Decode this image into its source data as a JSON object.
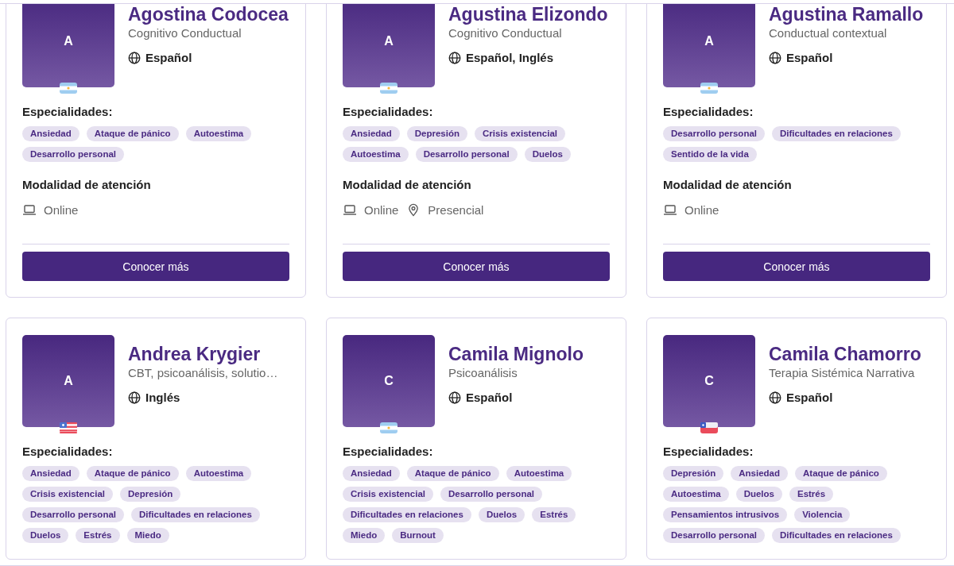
{
  "cards": [
    {
      "initial": "A",
      "flag": {
        "kind": "ar"
      },
      "name": "Agostina Codocea",
      "approach": "Cognitivo Conductual",
      "languages": "Español",
      "specialties_title": "Especialidades:",
      "specialties": [
        "Ansiedad",
        "Ataque de pánico",
        "Autoestima",
        "Desarrollo personal"
      ],
      "modality_title": "Modalidad de atención",
      "modalities": [
        {
          "kind": "online",
          "label": "Online"
        }
      ],
      "button": "Conocer más"
    },
    {
      "initial": "A",
      "flag": {
        "kind": "ar"
      },
      "name": "Agustina Elizondo",
      "approach": "Cognitivo Conductual",
      "languages": "Español, Inglés",
      "specialties_title": "Especialidades:",
      "specialties": [
        "Ansiedad",
        "Depresión",
        "Crisis existencial",
        "Autoestima",
        "Desarrollo personal",
        "Duelos"
      ],
      "modality_title": "Modalidad de atención",
      "modalities": [
        {
          "kind": "online",
          "label": "Online"
        },
        {
          "kind": "in_person",
          "label": "Presencial"
        }
      ],
      "button": "Conocer más"
    },
    {
      "initial": "A",
      "flag": {
        "kind": "ar"
      },
      "name": "Agustina Ramallo",
      "approach": "Conductual contextual",
      "languages": "Español",
      "specialties_title": "Especialidades:",
      "specialties": [
        "Desarrollo personal",
        "Dificultades en relaciones",
        "Sentido de la vida"
      ],
      "modality_title": "Modalidad de atención",
      "modalities": [
        {
          "kind": "online",
          "label": "Online"
        }
      ],
      "button": "Conocer más"
    },
    {
      "initial": "A",
      "flag": {
        "kind": "us"
      },
      "name": "Andrea Krygier",
      "approach": "CBT, psicoanálisis, solutio…",
      "languages": "Inglés",
      "specialties_title": "Especialidades:",
      "specialties": [
        "Ansiedad",
        "Ataque de pánico",
        "Autoestima",
        "Crisis existencial",
        "Depresión",
        "Desarrollo personal",
        "Dificultades en relaciones",
        "Duelos",
        "Estrés",
        "Miedo"
      ]
    },
    {
      "initial": "C",
      "flag": {
        "kind": "ar"
      },
      "name": "Camila Mignolo",
      "approach": "Psicoanálisis",
      "languages": "Español",
      "specialties_title": "Especialidades:",
      "specialties": [
        "Ansiedad",
        "Ataque de pánico",
        "Autoestima",
        "Crisis existencial",
        "Desarrollo personal",
        "Dificultades en relaciones",
        "Duelos",
        "Estrés",
        "Miedo",
        "Burnout"
      ]
    },
    {
      "initial": "C",
      "flag": {
        "kind": "cl"
      },
      "name": "Camila Chamorro",
      "approach": "Terapia Sistémica Narrativa",
      "languages": "Español",
      "specialties_title": "Especialidades:",
      "specialties": [
        "Depresión",
        "Ansiedad",
        "Ataque de pánico",
        "Autoestima",
        "Duelos",
        "Estrés",
        "Pensamientos intrusivos",
        "Violencia",
        "Desarrollo personal",
        "Dificultades en relaciones"
      ]
    }
  ]
}
